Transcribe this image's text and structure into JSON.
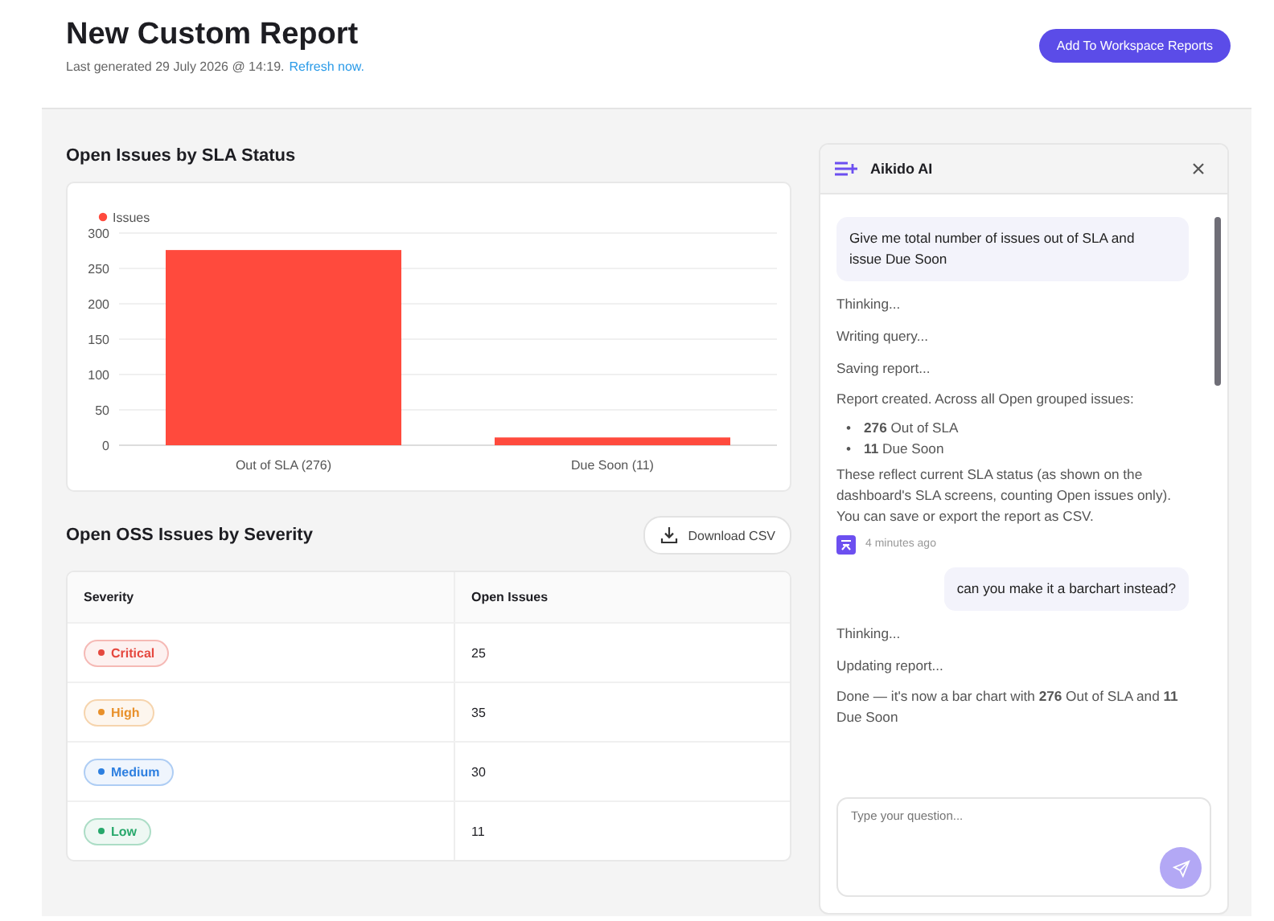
{
  "header": {
    "title": "New Custom Report",
    "subtitle": "Last generated 29 July 2026 @ 14:19.",
    "refresh_link": "Refresh now.",
    "action_button": "Add To Workspace Reports"
  },
  "sla_chart": {
    "title": "Open Issues by SLA Status",
    "chart_data": {
      "type": "bar",
      "categories": [
        "Out of SLA (276)",
        "Due Soon (11)"
      ],
      "series": [
        {
          "name": "Issues",
          "color": "#ff4a3d",
          "values": [
            276,
            11
          ]
        }
      ],
      "ylim": [
        0,
        300
      ],
      "grid": true,
      "yticks": [
        0,
        50,
        100,
        150,
        200,
        250,
        300
      ]
    }
  },
  "severity_table": {
    "title": "Open OSS Issues by Severity",
    "download_button": "Download CSV",
    "columns": [
      "Severity",
      "Open Issues"
    ],
    "rows": [
      {
        "severity": "Critical",
        "color": "#e5483f",
        "count": "25"
      },
      {
        "severity": "High",
        "color": "#e8902a",
        "count": "35"
      },
      {
        "severity": "Medium",
        "color": "#2d7fe0",
        "count": "30"
      },
      {
        "severity": "Low",
        "color": "#27a86b",
        "count": "11"
      }
    ]
  },
  "chat": {
    "title": "Aikido AI",
    "messages": [
      {
        "kind": "user",
        "text": "Give me total number of issues out of SLA and issue Due Soon"
      },
      {
        "kind": "status",
        "text": "Thinking..."
      },
      {
        "kind": "status",
        "text": "Writing query..."
      },
      {
        "kind": "status",
        "text": "Saving report..."
      },
      {
        "kind": "text",
        "text": "Report created. Across all Open grouped issues:"
      },
      {
        "kind": "bullets",
        "marker": "•",
        "items": [
          "**276** Out of SLA",
          "**11** Due Soon"
        ]
      },
      {
        "kind": "text",
        "text": "These reflect current SLA status (as shown on the dashboard's SLA screens, counting Open issues only). You can save or export the report as CSV."
      },
      {
        "kind": "meta",
        "text": "4 minutes ago"
      },
      {
        "kind": "user",
        "text": "can you make it a barchart instead?"
      },
      {
        "kind": "status",
        "text": "Thinking..."
      },
      {
        "kind": "status",
        "text": "Updating report..."
      },
      {
        "kind": "text",
        "text": "Done — it's now a bar chart with **276** Out of SLA and **11** Due Soon"
      }
    ],
    "input": {
      "placeholder": "Type your question..."
    }
  }
}
